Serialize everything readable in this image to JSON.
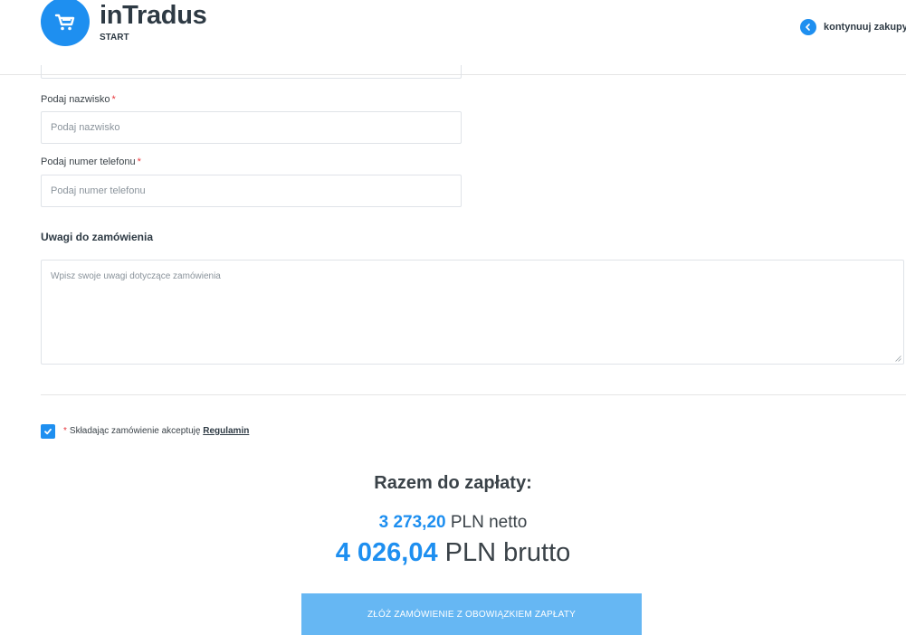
{
  "header": {
    "logo_title": "inTradus",
    "logo_subtitle": "START",
    "continue_label": "kontynuuj zakupy"
  },
  "form": {
    "last_name": {
      "label": "Podaj nazwisko",
      "placeholder": "Podaj nazwisko",
      "required_mark": "*"
    },
    "phone": {
      "label": "Podaj numer telefonu",
      "placeholder": "Podaj numer telefonu",
      "required_mark": "*"
    },
    "notes": {
      "title": "Uwagi do zamówienia",
      "placeholder": "Wpisz swoje uwagi dotyczące zamówienia"
    }
  },
  "terms": {
    "checked": true,
    "required_mark": "*",
    "text": "Składając zamówienie akceptuję ",
    "link_label": "Regulamin"
  },
  "summary": {
    "title": "Razem do zapłaty:",
    "netto_value": "3 273,20",
    "netto_suffix": " PLN netto",
    "brutto_value": "4 026,04",
    "brutto_suffix": " PLN brutto"
  },
  "submit_label": "ZŁÓŻ ZAMÓWIENIE Z OBOWIĄZKIEM ZAPŁATY",
  "colors": {
    "accent": "#1e8ff0",
    "button": "#66b7f3",
    "required": "#e8383d"
  }
}
